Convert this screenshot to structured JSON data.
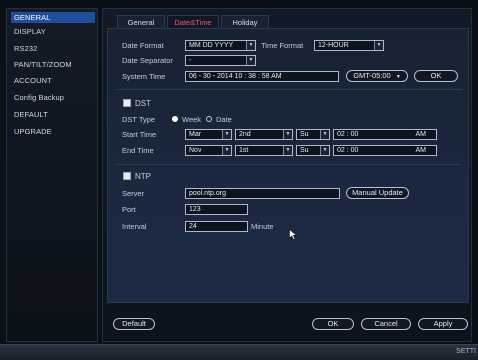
{
  "sidebar": {
    "items": [
      {
        "label": "GENERAL",
        "active": true
      },
      {
        "label": "DISPLAY",
        "active": false
      },
      {
        "label": "RS232",
        "active": false
      },
      {
        "label": "PAN/TILT/ZOOM",
        "active": false
      },
      {
        "label": "ACCOUNT",
        "active": false
      },
      {
        "label": "Config Backup",
        "active": false
      },
      {
        "label": "DEFAULT",
        "active": false
      },
      {
        "label": "UPGRADE",
        "active": false
      }
    ]
  },
  "tabs": [
    {
      "label": "General",
      "active": false
    },
    {
      "label": "Date&Time",
      "active": true
    },
    {
      "label": "Holiday",
      "active": false
    }
  ],
  "datetime": {
    "date_format_label": "Date Format",
    "date_format_value": "MM DD YYYY",
    "time_format_label": "Time Format",
    "time_format_value": "12-HOUR",
    "date_separator_label": "Date Separator",
    "date_separator_value": "-",
    "system_time_label": "System Time",
    "system_time_value": "06 - 30 - 2014   10 : 38 : 58 AM",
    "timezone_value": "GMT-05:00",
    "ok_label": "OK"
  },
  "dst": {
    "label": "DST",
    "checked": false,
    "type_label": "DST Type",
    "week_label": "Week",
    "date_label": "Date",
    "selected_type": "Week",
    "start_label": "Start Time",
    "start_month": "Mar",
    "start_week": "2nd",
    "start_day": "Su",
    "start_time": "02 : 00",
    "start_ampm": "AM",
    "end_label": "End Time",
    "end_month": "Nov",
    "end_week": "1st",
    "end_day": "Su",
    "end_time": "02 : 00",
    "end_ampm": "AM"
  },
  "ntp": {
    "label": "NTP",
    "checked": false,
    "server_label": "Server",
    "server_value": "pool.ntp.org",
    "manual_update_label": "Manual Update",
    "port_label": "Port",
    "port_value": "123",
    "interval_label": "Interval",
    "interval_value": "24",
    "interval_unit": "Minute"
  },
  "footer": {
    "default_label": "Default",
    "ok_label": "OK",
    "cancel_label": "Cancel",
    "apply_label": "Apply"
  },
  "bottom_bar": {
    "text": "SETTI"
  }
}
